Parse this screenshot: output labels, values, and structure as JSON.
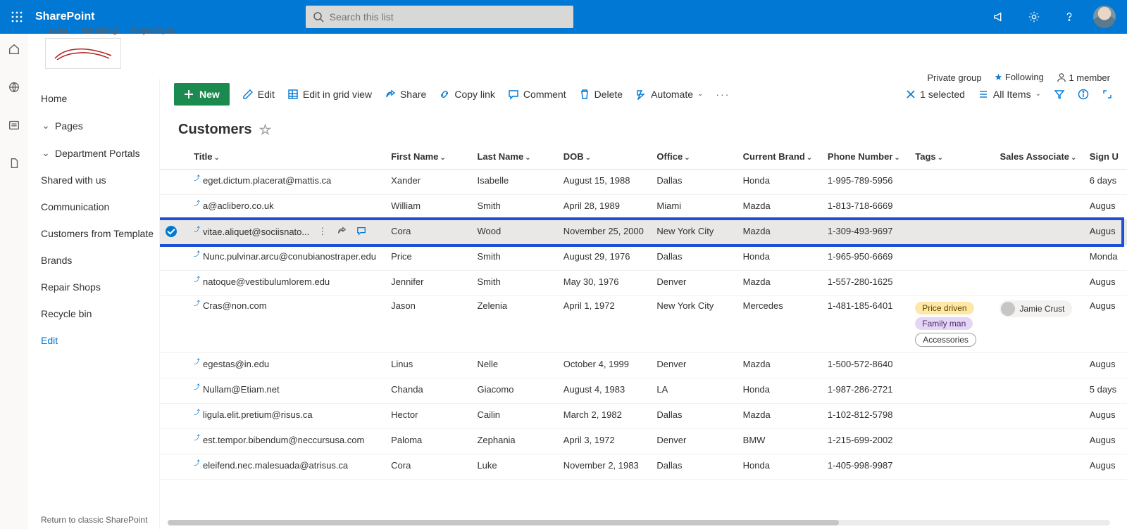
{
  "suite": {
    "app_name": "SharePoint",
    "search_placeholder": "Search this list"
  },
  "site": {
    "links": [
      "Sales",
      "Marketing",
      "ProjectApex"
    ],
    "group_type": "Private group",
    "following_label": "Following",
    "members_label": "1 member"
  },
  "nav": {
    "items": [
      {
        "label": "Home",
        "kind": "item"
      },
      {
        "label": "Pages",
        "kind": "expand"
      },
      {
        "label": "Department Portals",
        "kind": "expand"
      },
      {
        "label": "Shared with us",
        "kind": "item"
      },
      {
        "label": "Communication",
        "kind": "item"
      },
      {
        "label": "Customers from Template",
        "kind": "item"
      },
      {
        "label": "Brands",
        "kind": "item"
      },
      {
        "label": "Repair Shops",
        "kind": "item"
      },
      {
        "label": "Recycle bin",
        "kind": "item"
      },
      {
        "label": "Edit",
        "kind": "link"
      }
    ],
    "return_label": "Return to classic SharePoint"
  },
  "cmd": {
    "new": "New",
    "edit": "Edit",
    "grid": "Edit in grid view",
    "share": "Share",
    "copy": "Copy link",
    "comment": "Comment",
    "delete": "Delete",
    "automate": "Automate",
    "selected": "1 selected",
    "view": "All Items"
  },
  "list": {
    "title": "Customers",
    "columns": [
      "Title",
      "First Name",
      "Last Name",
      "DOB",
      "Office",
      "Current Brand",
      "Phone Number",
      "Tags",
      "Sales Associate",
      "Sign U"
    ],
    "rows": [
      {
        "title": "eget.dictum.placerat@mattis.ca",
        "fn": "Xander",
        "ln": "Isabelle",
        "dob": "August 15, 1988",
        "office": "Dallas",
        "brand": "Honda",
        "phone": "1-995-789-5956",
        "tags": [],
        "assoc": "",
        "sign": "6 days"
      },
      {
        "title": "a@aclibero.co.uk",
        "fn": "William",
        "ln": "Smith",
        "dob": "April 28, 1989",
        "office": "Miami",
        "brand": "Mazda",
        "phone": "1-813-718-6669",
        "tags": [],
        "assoc": "",
        "sign": "Augus"
      },
      {
        "title": "vitae.aliquet@sociisnato...",
        "fn": "Cora",
        "ln": "Wood",
        "dob": "November 25, 2000",
        "office": "New York City",
        "brand": "Mazda",
        "phone": "1-309-493-9697",
        "tags": [],
        "assoc": "",
        "sign": "Augus",
        "selected": true
      },
      {
        "title": "Nunc.pulvinar.arcu@conubianostraper.edu",
        "fn": "Price",
        "ln": "Smith",
        "dob": "August 29, 1976",
        "office": "Dallas",
        "brand": "Honda",
        "phone": "1-965-950-6669",
        "tags": [],
        "assoc": "",
        "sign": "Monda"
      },
      {
        "title": "natoque@vestibulumlorem.edu",
        "fn": "Jennifer",
        "ln": "Smith",
        "dob": "May 30, 1976",
        "office": "Denver",
        "brand": "Mazda",
        "phone": "1-557-280-1625",
        "tags": [],
        "assoc": "",
        "sign": "Augus"
      },
      {
        "title": "Cras@non.com",
        "fn": "Jason",
        "ln": "Zelenia",
        "dob": "April 1, 1972",
        "office": "New York City",
        "brand": "Mercedes",
        "phone": "1-481-185-6401",
        "tags": [
          "Price driven",
          "Family man",
          "Accessories"
        ],
        "assoc": "Jamie Crust",
        "sign": "Augus"
      },
      {
        "title": "egestas@in.edu",
        "fn": "Linus",
        "ln": "Nelle",
        "dob": "October 4, 1999",
        "office": "Denver",
        "brand": "Mazda",
        "phone": "1-500-572-8640",
        "tags": [],
        "assoc": "",
        "sign": "Augus"
      },
      {
        "title": "Nullam@Etiam.net",
        "fn": "Chanda",
        "ln": "Giacomo",
        "dob": "August 4, 1983",
        "office": "LA",
        "brand": "Honda",
        "phone": "1-987-286-2721",
        "tags": [],
        "assoc": "",
        "sign": "5 days"
      },
      {
        "title": "ligula.elit.pretium@risus.ca",
        "fn": "Hector",
        "ln": "Cailin",
        "dob": "March 2, 1982",
        "office": "Dallas",
        "brand": "Mazda",
        "phone": "1-102-812-5798",
        "tags": [],
        "assoc": "",
        "sign": "Augus"
      },
      {
        "title": "est.tempor.bibendum@neccursusa.com",
        "fn": "Paloma",
        "ln": "Zephania",
        "dob": "April 3, 1972",
        "office": "Denver",
        "brand": "BMW",
        "phone": "1-215-699-2002",
        "tags": [],
        "assoc": "",
        "sign": "Augus"
      },
      {
        "title": "eleifend.nec.malesuada@atrisus.ca",
        "fn": "Cora",
        "ln": "Luke",
        "dob": "November 2, 1983",
        "office": "Dallas",
        "brand": "Honda",
        "phone": "1-405-998-9987",
        "tags": [],
        "assoc": "",
        "sign": "Augus"
      }
    ]
  }
}
